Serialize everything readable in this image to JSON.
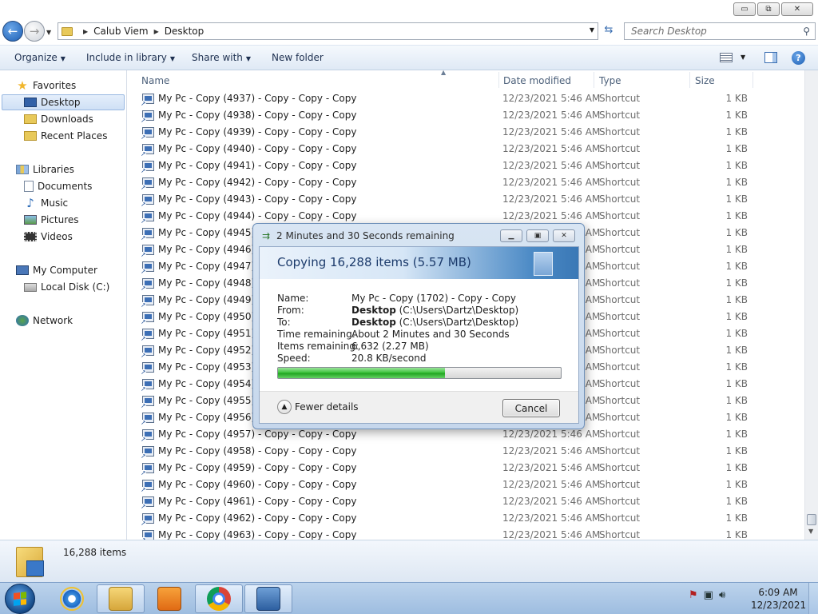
{
  "titlebar": {
    "minimize": "▭",
    "maximize": "⧉",
    "close": "✕"
  },
  "address": {
    "crumbs": [
      "Calub Viem",
      "Desktop"
    ],
    "search_placeholder": "Search Desktop"
  },
  "commandbar": {
    "organize": "Organize",
    "include_in_library": "Include in library",
    "share_with": "Share with",
    "new_folder": "New folder"
  },
  "navpane": {
    "favorites": "Favorites",
    "desktop": "Desktop",
    "downloads": "Downloads",
    "recent_places": "Recent Places",
    "libraries": "Libraries",
    "documents": "Documents",
    "music": "Music",
    "pictures": "Pictures",
    "videos": "Videos",
    "my_computer": "My Computer",
    "local_disk": "Local Disk (C:)",
    "network": "Network"
  },
  "columns": {
    "name": "Name",
    "date_modified": "Date modified",
    "type": "Type",
    "size": "Size"
  },
  "files": [
    {
      "name": "My Pc - Copy (4937) - Copy - Copy - Copy",
      "date": "12/23/2021 5:46 AM",
      "type": "Shortcut",
      "size": "1 KB"
    },
    {
      "name": "My Pc - Copy (4938) - Copy - Copy - Copy",
      "date": "12/23/2021 5:46 AM",
      "type": "Shortcut",
      "size": "1 KB"
    },
    {
      "name": "My Pc - Copy (4939) - Copy - Copy - Copy",
      "date": "12/23/2021 5:46 AM",
      "type": "Shortcut",
      "size": "1 KB"
    },
    {
      "name": "My Pc - Copy (4940) - Copy - Copy - Copy",
      "date": "12/23/2021 5:46 AM",
      "type": "Shortcut",
      "size": "1 KB"
    },
    {
      "name": "My Pc - Copy (4941) - Copy - Copy - Copy",
      "date": "12/23/2021 5:46 AM",
      "type": "Shortcut",
      "size": "1 KB"
    },
    {
      "name": "My Pc - Copy (4942) - Copy - Copy - Copy",
      "date": "12/23/2021 5:46 AM",
      "type": "Shortcut",
      "size": "1 KB"
    },
    {
      "name": "My Pc - Copy (4943) - Copy - Copy - Copy",
      "date": "12/23/2021 5:46 AM",
      "type": "Shortcut",
      "size": "1 KB"
    },
    {
      "name": "My Pc - Copy (4944) - Copy - Copy - Copy",
      "date": "12/23/2021 5:46 AM",
      "type": "Shortcut",
      "size": "1 KB"
    },
    {
      "name": "My Pc - Copy (4945) - Copy - Copy - Copy",
      "date": "12/23/2021 5:46 AM",
      "type": "Shortcut",
      "size": "1 KB"
    },
    {
      "name": "My Pc - Copy (4946) - Copy - Copy - Copy",
      "date": "12/23/2021 5:46 AM",
      "type": "Shortcut",
      "size": "1 KB"
    },
    {
      "name": "My Pc - Copy (4947) - Copy - Copy - Copy",
      "date": "12/23/2021 5:46 AM",
      "type": "Shortcut",
      "size": "1 KB"
    },
    {
      "name": "My Pc - Copy (4948) - Copy - Copy - Copy",
      "date": "12/23/2021 5:46 AM",
      "type": "Shortcut",
      "size": "1 KB"
    },
    {
      "name": "My Pc - Copy (4949) - Copy - Copy - Copy",
      "date": "12/23/2021 5:46 AM",
      "type": "Shortcut",
      "size": "1 KB"
    },
    {
      "name": "My Pc - Copy (4950) - Copy - Copy - Copy",
      "date": "12/23/2021 5:46 AM",
      "type": "Shortcut",
      "size": "1 KB"
    },
    {
      "name": "My Pc - Copy (4951) - Copy - Copy - Copy",
      "date": "12/23/2021 5:46 AM",
      "type": "Shortcut",
      "size": "1 KB"
    },
    {
      "name": "My Pc - Copy (4952) - Copy - Copy - Copy",
      "date": "12/23/2021 5:46 AM",
      "type": "Shortcut",
      "size": "1 KB"
    },
    {
      "name": "My Pc - Copy (4953) - Copy - Copy - Copy",
      "date": "12/23/2021 5:46 AM",
      "type": "Shortcut",
      "size": "1 KB"
    },
    {
      "name": "My Pc - Copy (4954) - Copy - Copy - Copy",
      "date": "12/23/2021 5:46 AM",
      "type": "Shortcut",
      "size": "1 KB"
    },
    {
      "name": "My Pc - Copy (4955) - Copy - Copy - Copy",
      "date": "12/23/2021 5:46 AM",
      "type": "Shortcut",
      "size": "1 KB"
    },
    {
      "name": "My Pc - Copy (4956) - Copy - Copy - Copy",
      "date": "12/23/2021 5:46 AM",
      "type": "Shortcut",
      "size": "1 KB"
    },
    {
      "name": "My Pc - Copy (4957) - Copy - Copy - Copy",
      "date": "12/23/2021 5:46 AM",
      "type": "Shortcut",
      "size": "1 KB"
    },
    {
      "name": "My Pc - Copy (4958) - Copy - Copy - Copy",
      "date": "12/23/2021 5:46 AM",
      "type": "Shortcut",
      "size": "1 KB"
    },
    {
      "name": "My Pc - Copy (4959) - Copy - Copy - Copy",
      "date": "12/23/2021 5:46 AM",
      "type": "Shortcut",
      "size": "1 KB"
    },
    {
      "name": "My Pc - Copy (4960) - Copy - Copy - Copy",
      "date": "12/23/2021 5:46 AM",
      "type": "Shortcut",
      "size": "1 KB"
    },
    {
      "name": "My Pc - Copy (4961) - Copy - Copy - Copy",
      "date": "12/23/2021 5:46 AM",
      "type": "Shortcut",
      "size": "1 KB"
    },
    {
      "name": "My Pc - Copy (4962) - Copy - Copy - Copy",
      "date": "12/23/2021 5:46 AM",
      "type": "Shortcut",
      "size": "1 KB"
    },
    {
      "name": "My Pc - Copy (4963) - Copy - Copy - Copy",
      "date": "12/23/2021 5:46 AM",
      "type": "Shortcut",
      "size": "1 KB"
    }
  ],
  "details": {
    "item_count": "16,288 items"
  },
  "dialog": {
    "title": "2 Minutes and 30 Seconds remaining",
    "heading": "Copying 16,288 items (5.57 MB)",
    "labels": {
      "name": "Name:",
      "from": "From:",
      "to": "To:",
      "time_remaining": "Time remaining:",
      "items_remaining": "Items remaining:",
      "speed": "Speed:"
    },
    "name_value": "My Pc - Copy (1702) - Copy - Copy",
    "from_bold": "Desktop",
    "from_path": "(C:\\Users\\Dartz\\Desktop)",
    "to_bold": "Desktop",
    "to_path": "(C:\\Users\\Dartz\\Desktop)",
    "time_remaining_value": "About 2 Minutes and 30 Seconds",
    "items_remaining_value": "6,632 (2.27 MB)",
    "speed_value": "20.8 KB/second",
    "progress": 0.59,
    "fewer_details": "Fewer details",
    "cancel": "Cancel"
  },
  "taskbar": {
    "apps": [
      "internet-explorer-icon",
      "windows-explorer-icon",
      "media-player-icon",
      "chrome-icon",
      "remote-desktop-icon"
    ],
    "time": "6:09 AM",
    "date": "12/23/2021"
  },
  "colors": {
    "accent": "#1d5fb4",
    "progress_green": "#37c237",
    "command_bar": "#dfe9f5"
  }
}
